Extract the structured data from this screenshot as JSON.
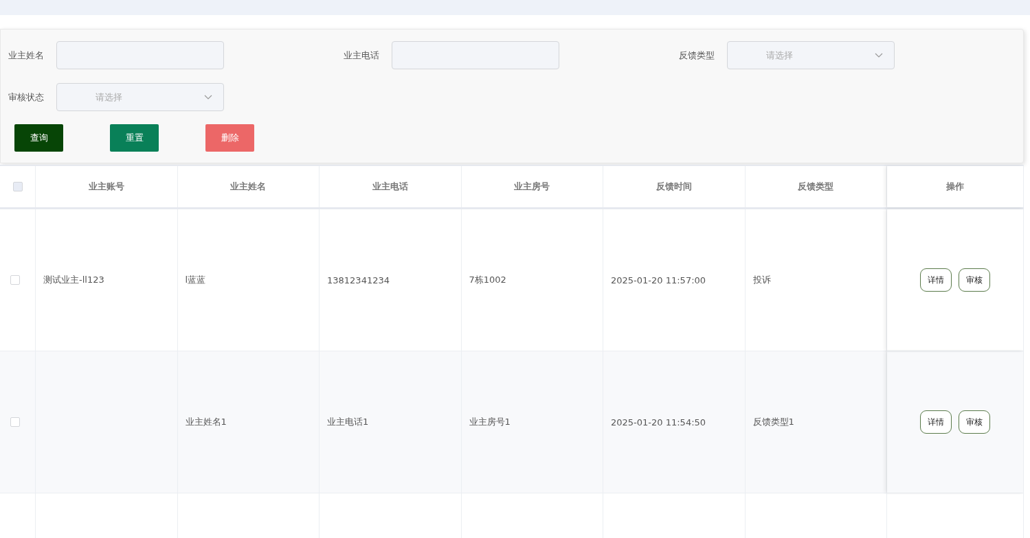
{
  "filters": [
    {
      "kind": "input",
      "label": "业主姓名"
    },
    {
      "kind": "input",
      "label": "业主电话"
    },
    {
      "kind": "select",
      "label": "反馈类型",
      "placeholder": "请选择"
    },
    {
      "kind": "select",
      "label": "审核状态",
      "placeholder": "请选择"
    }
  ],
  "buttons": [
    {
      "kind": "query",
      "label": "查询"
    },
    {
      "kind": "reset",
      "label": "重置"
    },
    {
      "kind": "delete",
      "label": "删除"
    }
  ],
  "table": {
    "header_checked": false,
    "columns": [
      "业主账号",
      "业主姓名",
      "业主电话",
      "业主房号",
      "反馈时间",
      "反馈类型",
      "操作"
    ],
    "rows": [
      {
        "checked": false,
        "cells": [
          "测试业主-ll123",
          "l蓝蓝",
          "13812341234",
          "7栋1002",
          "2025-01-20 11:57:00",
          "投诉"
        ],
        "actions": [
          "详情",
          "审核"
        ]
      },
      {
        "checked": false,
        "cells": [
          "",
          "业主姓名1",
          "业主电话1",
          "业主房号1",
          "2025-01-20 11:54:50",
          "反馈类型1"
        ],
        "actions": [
          "详情",
          "审核"
        ]
      }
    ]
  }
}
